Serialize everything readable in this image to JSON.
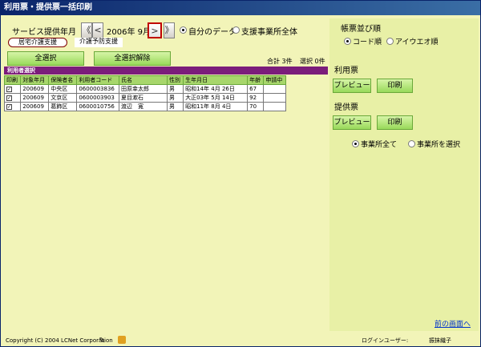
{
  "window": {
    "title": "利用票・提供票一括印刷"
  },
  "header": {
    "service_month_label": "サービス提供年月",
    "nav_first": "《",
    "nav_prev": "<",
    "year_month": "2006年 9月",
    "nav_next": ">",
    "nav_last": "》",
    "option_own": "自分のデータ",
    "option_all": "支援事業所全体"
  },
  "tabs": {
    "kaigo": "居宅介護支援",
    "yobou": "介護予防支援"
  },
  "toolbar": {
    "select_all": "全選択",
    "deselect_all": "全選択解除",
    "total": "合計 3件",
    "selected": "選択 0件"
  },
  "section": {
    "users_title": "利用者選択"
  },
  "table": {
    "columns": [
      "印刷",
      "対象年月",
      "保険者名",
      "利用者コード",
      "氏名",
      "性別",
      "生年月日",
      "年齢",
      "申請中"
    ],
    "rows": [
      {
        "print": "✓",
        "ym": "200609",
        "insurer": "中央区",
        "code": "0600003836",
        "name": "田原幸太郎",
        "sex": "男",
        "birth": "昭和14年 4月 26日",
        "age": "67",
        "apply": ""
      },
      {
        "print": "✓",
        "ym": "200609",
        "insurer": "文京区",
        "code": "0600003903",
        "name": "夏目漱石",
        "sex": "男",
        "birth": "大正03年 5月 14日",
        "age": "92",
        "apply": ""
      },
      {
        "print": "✓",
        "ym": "200609",
        "insurer": "葛飾区",
        "code": "0600010756",
        "name": "渡辺　寛",
        "sex": "男",
        "birth": "昭和11年 8月 4日",
        "age": "70",
        "apply": ""
      }
    ]
  },
  "side": {
    "order_title": "帳票並び順",
    "order_code": "コード順",
    "order_kana": "アイウエオ順",
    "riyou_title": "利用票",
    "riyou_preview": "プレビュー",
    "riyou_print": "印刷",
    "teikyou_title": "提供票",
    "teikyou_preview": "プレビュー",
    "teikyou_print": "印刷",
    "office_all": "事業所全て",
    "office_select": "事業所を選択",
    "back_link": "前の画面へ"
  },
  "footer": {
    "copyright": "Copyright (C) 2004 LCNet Corporation",
    "login_label": "ログインユーザー:",
    "login_user": "振抹織子"
  },
  "colors": {
    "accent": "#7b1d7b",
    "button_green": "#98d95a",
    "panel": "#f2f4b8",
    "highlight_border": "#c00000"
  }
}
